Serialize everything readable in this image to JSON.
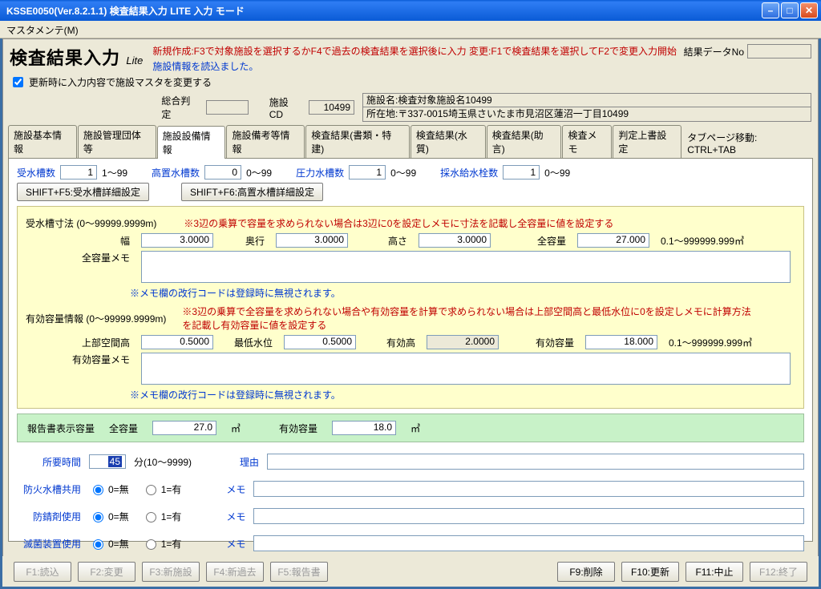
{
  "window": {
    "title": "KSSE0050(Ver.8.2.1.1) 検査結果入力 LITE 入力 モード"
  },
  "menu": {
    "master": "マスタメンテ(M)"
  },
  "header": {
    "title": "検査結果入力",
    "lite": "Lite",
    "guide": "新規作成:F3で対象施設を選択するかF4で過去の検査結果を選択後に入力 変更:F1で検査結果を選択してF2で変更入力開始",
    "loaded": "施設情報を読込ました。",
    "updateFlag": "更新時に入力内容で施設マスタを変更する",
    "resultNoLabel": "結果データNo",
    "resultNoValue": "",
    "sogo": "総合判定",
    "sogoValue": "",
    "shisetsuCDLabel": "施設CD",
    "shisetsuCD": "10499",
    "shisetsuNameLabel": "施設名:",
    "shisetsuName": "検査対象施設名10499",
    "addrLabel": "所在地:",
    "addr": "〒337-0015埼玉県さいたま市見沼区蓮沼一丁目10499"
  },
  "tabs": {
    "t1": "施設基本情報",
    "t2": "施設管理団体等",
    "t3": "施設設備情報",
    "t4": "施設備考等情報",
    "t5": "検査結果(書類・特建)",
    "t6": "検査結果(水質)",
    "t7": "検査結果(助言)",
    "t8": "検査メモ",
    "t9": "判定上書設定",
    "hint": "タブページ移動: CTRL+TAB"
  },
  "counts": {
    "jusuiLabel": "受水槽数",
    "jusui": "1",
    "jusuiRange": "1～99",
    "kochiLabel": "高置水槽数",
    "kochi": "0",
    "kochiRange": "0～99",
    "atsuLabel": "圧力水槽数",
    "atsu": "1",
    "atsuRange": "0～99",
    "saisuiLabel": "採水給水栓数",
    "saisui": "1",
    "saisuiRange": "0～99",
    "btn1": "SHIFT+F5:受水槽詳細設定",
    "btn2": "SHIFT+F6:高置水槽詳細設定"
  },
  "dims": {
    "title": "受水槽寸法 (0～99999.9999m)",
    "note": "※3辺の乗算で容量を求められない場合は3辺に0を設定しメモに寸法を記載し全容量に値を設定する",
    "haba": "幅",
    "habaV": "3.0000",
    "oku": "奥行",
    "okuV": "3.0000",
    "taka": "高さ",
    "takaV": "3.0000",
    "zen": "全容量",
    "zenV": "27.000",
    "zenRange": "0.1～999999.999㎥",
    "memo": "全容量メモ",
    "memoNote": "※メモ欄の改行コードは登録時に無視されます。"
  },
  "eff": {
    "title": "有効容量情報 (0～99999.9999m)",
    "note": "※3辺の乗算で全容量を求められない場合や有効容量を計算で求められない場合は上部空間高と最低水位に0を設定しメモに計算方法を記載し有効容量に値を設定する",
    "jobu": "上部空間高",
    "jobuV": "0.5000",
    "sai": "最低水位",
    "saiV": "0.5000",
    "yuko": "有効高",
    "yukoV": "2.0000",
    "yoryo": "有効容量",
    "yoryoV": "18.000",
    "yoryoRange": "0.1～999999.999㎥",
    "memo": "有効容量メモ",
    "memoNote": "※メモ欄の改行コードは登録時に無視されます。"
  },
  "report": {
    "label": "報告書表示容量",
    "zen": "全容量",
    "zenV": "27.0",
    "zenUnit": "㎥",
    "yuko": "有効容量",
    "yukoV": "18.0",
    "yukoUnit": "㎥"
  },
  "lower": {
    "shoyo": "所要時間",
    "shoyoV": "45",
    "shoyoUnit": "分(10～9999)",
    "riyu": "理由",
    "boka": "防火水槽共用",
    "bosei": "防錆剤使用",
    "mekkin": "滅菌装置使用",
    "opt0": "0=無",
    "opt1": "1=有",
    "memo": "メモ"
  },
  "fkeys": {
    "f1": "F1:読込",
    "f2": "F2:変更",
    "f3": "F3:新施設",
    "f4": "F4:新過去",
    "f5": "F5:報告書",
    "f9": "F9:削除",
    "f10": "F10:更新",
    "f11": "F11:中止",
    "f12": "F12:終了"
  }
}
